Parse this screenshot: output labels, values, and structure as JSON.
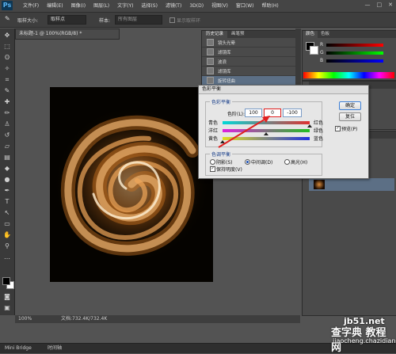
{
  "app": {
    "logo": "Ps"
  },
  "menubar": {
    "items": [
      "文件(F)",
      "编辑(E)",
      "图像(I)",
      "图层(L)",
      "文字(Y)",
      "选择(S)",
      "滤镜(T)",
      "3D(D)",
      "视图(V)",
      "窗口(W)",
      "帮助(H)"
    ],
    "window_controls": [
      "—",
      "□",
      "✕"
    ]
  },
  "options_bar": {
    "sample_size_label": "取样大小:",
    "sample_size_value": "取样点",
    "sample_label": "样本:",
    "sample_value": "所有图层",
    "show_ring_label": "显示取样环"
  },
  "document": {
    "tab_title": "未标题-1 @ 100%(RGB/8) *",
    "zoom": "100%",
    "doc_info": "文档:732.4K/732.4K"
  },
  "history_panel": {
    "tabs": [
      "历史记录",
      "画笔预"
    ],
    "items": [
      "镜头光晕",
      "滤镜库",
      "波浪",
      "滤镜库",
      "旋转扭曲"
    ],
    "selected_index": 4
  },
  "color_panel": {
    "tabs": [
      "颜色",
      "色板"
    ],
    "channels": [
      "R",
      "G",
      "B"
    ]
  },
  "dialog": {
    "title": "色彩平衡",
    "balance_group": "色彩平衡",
    "levels_label": "色阶(L):",
    "levels": [
      "100",
      "0",
      "-100"
    ],
    "sliders": [
      {
        "left": "青色",
        "right": "红色",
        "position": 1.0
      },
      {
        "left": "洋红",
        "right": "绿色",
        "position": 0.5
      },
      {
        "left": "黄色",
        "right": "蓝色",
        "position": 0.0
      }
    ],
    "tone_group": "色调平衡",
    "tone_options": [
      "阴影(S)",
      "中间调(D)",
      "高光(H)"
    ],
    "tone_selected": 1,
    "preserve_luminosity": "保持明度(V)",
    "ok_label": "确定",
    "reset_label": "复位",
    "preview_label": "预览(P)"
  },
  "bottom_bar": {
    "tabs": [
      "Mini Bridge",
      "时间轴"
    ]
  },
  "watermark": {
    "line1": "jb51.net",
    "line2": "查字典 教程网",
    "line3": "jiaocheng.chazidian.com"
  },
  "colors": {
    "accent_red": "#e02020",
    "selection": "#5c6f85",
    "canvas_bg": "#050300",
    "swirl": "#d9822b"
  }
}
